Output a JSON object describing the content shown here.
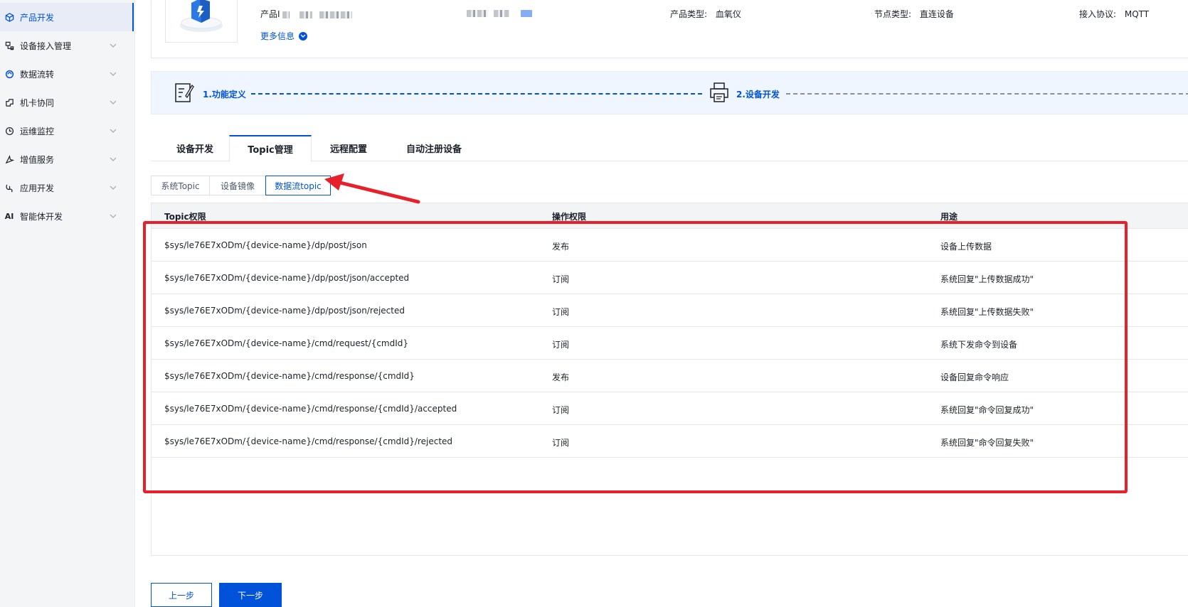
{
  "sidebar": {
    "items": [
      {
        "label": "产品开发",
        "icon": "cube-icon",
        "active": true
      },
      {
        "label": "设备接入管理",
        "icon": "device-access-icon"
      },
      {
        "label": "数据流转",
        "icon": "data-flow-icon"
      },
      {
        "label": "机卡协同",
        "icon": "sim-link-icon"
      },
      {
        "label": "运维监控",
        "icon": "monitor-icon"
      },
      {
        "label": "增值服务",
        "icon": "value-added-icon"
      },
      {
        "label": "应用开发",
        "icon": "app-dev-icon"
      },
      {
        "label": "智能体开发",
        "icon": "ai-icon",
        "icon_text": "AI"
      }
    ]
  },
  "product": {
    "id_label": "产品I",
    "type_label": "产品类型:",
    "type_value": "血氧仪",
    "node_label": "节点类型:",
    "node_value": "直连设备",
    "protocol_label": "接入协议:",
    "protocol_value": "MQTT",
    "more_info": "更多信息"
  },
  "steps": [
    {
      "label": "1.功能定义"
    },
    {
      "label": "2.设备开发"
    }
  ],
  "tabs": [
    {
      "label": "设备开发"
    },
    {
      "label": "Topic管理",
      "active": true
    },
    {
      "label": "远程配置"
    },
    {
      "label": "自动注册设备"
    }
  ],
  "subtabs": [
    {
      "label": "系统Topic"
    },
    {
      "label": "设备镜像"
    },
    {
      "label": "数据流topic",
      "active": true
    }
  ],
  "table": {
    "headers": [
      "Topic权限",
      "操作权限",
      "用途"
    ],
    "rows": [
      [
        "$sys/le76E7xODm/{device-name}/dp/post/json",
        "发布",
        "设备上传数据"
      ],
      [
        "$sys/le76E7xODm/{device-name}/dp/post/json/accepted",
        "订阅",
        "系统回复\"上传数据成功\""
      ],
      [
        "$sys/le76E7xODm/{device-name}/dp/post/json/rejected",
        "订阅",
        "系统回复\"上传数据失败\""
      ],
      [
        "$sys/le76E7xODm/{device-name}/cmd/request/{cmdId}",
        "订阅",
        "系统下发命令到设备"
      ],
      [
        "$sys/le76E7xODm/{device-name}/cmd/response/{cmdId}",
        "发布",
        "设备回复命令响应"
      ],
      [
        "$sys/le76E7xODm/{device-name}/cmd/response/{cmdId}/accepted",
        "订阅",
        "系统回复\"命令回复成功\""
      ],
      [
        "$sys/le76E7xODm/{device-name}/cmd/response/{cmdId}/rejected",
        "订阅",
        "系统回复\"命令回复失败\""
      ]
    ]
  },
  "buttons": {
    "prev": "上一步",
    "next": "下一步"
  },
  "colors": {
    "accent": "#0052d9",
    "annotation": "#e8202a"
  }
}
